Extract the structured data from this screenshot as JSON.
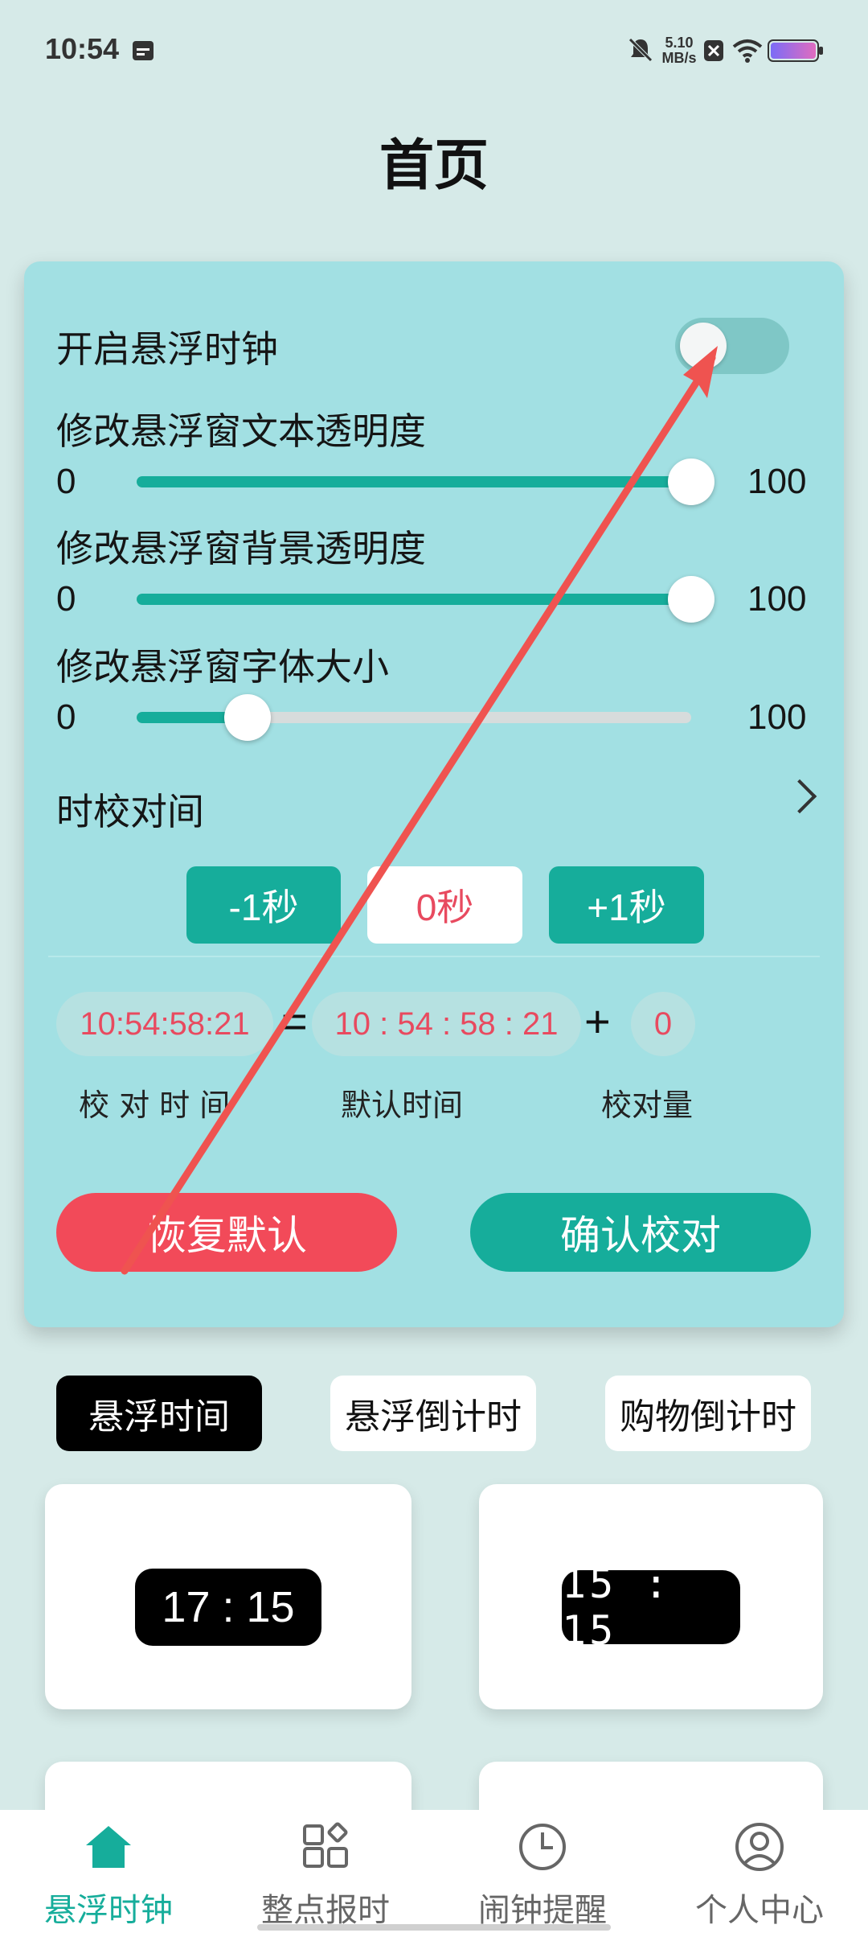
{
  "status_bar": {
    "time": "10:54",
    "net_speed_value": "5.10",
    "net_speed_unit": "MB/s",
    "icons": [
      "calendar-icon",
      "mute-bell-icon",
      "close-box-icon",
      "wifi-icon",
      "battery-icon"
    ]
  },
  "page": {
    "title": "首页"
  },
  "settings": {
    "enable_label": "开启悬浮时钟",
    "enable_on": false,
    "sliders": [
      {
        "label": "修改悬浮窗文本透明度",
        "min": "0",
        "max": "100",
        "value": 100
      },
      {
        "label": "修改悬浮窗背景透明度",
        "min": "0",
        "max": "100",
        "value": 100
      },
      {
        "label": "修改悬浮窗字体大小",
        "min": "0",
        "max": "100",
        "value": 20
      }
    ],
    "calibrate_label": "时校对间"
  },
  "adjust": {
    "minus": "-1秒",
    "current": "0秒",
    "plus": "+1秒"
  },
  "equation": {
    "calibrated_time": "10:54:58:21",
    "equals": "=",
    "default_time": "10 : 54 : 58 : 21",
    "plus": "+",
    "offset": "0",
    "label_calibrated": "校 对 时 间",
    "label_default": "默认时间",
    "label_offset": "校对量"
  },
  "actions": {
    "reset": "恢复默认",
    "confirm": "确认校对"
  },
  "mode_tabs": [
    {
      "label": "悬浮时间",
      "active": true
    },
    {
      "label": "悬浮倒计时",
      "active": false
    },
    {
      "label": "购物倒计时",
      "active": false
    }
  ],
  "styles": [
    {
      "time": "17 : 15"
    },
    {
      "time": "15 : 15"
    }
  ],
  "bottom_nav": [
    {
      "label": "悬浮时钟",
      "icon": "home-icon",
      "active": true
    },
    {
      "label": "整点报时",
      "icon": "grid-icon",
      "active": false
    },
    {
      "label": "闹钟提醒",
      "icon": "clock-icon",
      "active": false
    },
    {
      "label": "个人中心",
      "icon": "person-icon",
      "active": false
    }
  ],
  "colors": {
    "accent": "#16ad9b",
    "card": "#a2e0e3",
    "danger": "#f24a59",
    "background": "#d6eae8",
    "annotation_arrow": "#ef5350"
  }
}
